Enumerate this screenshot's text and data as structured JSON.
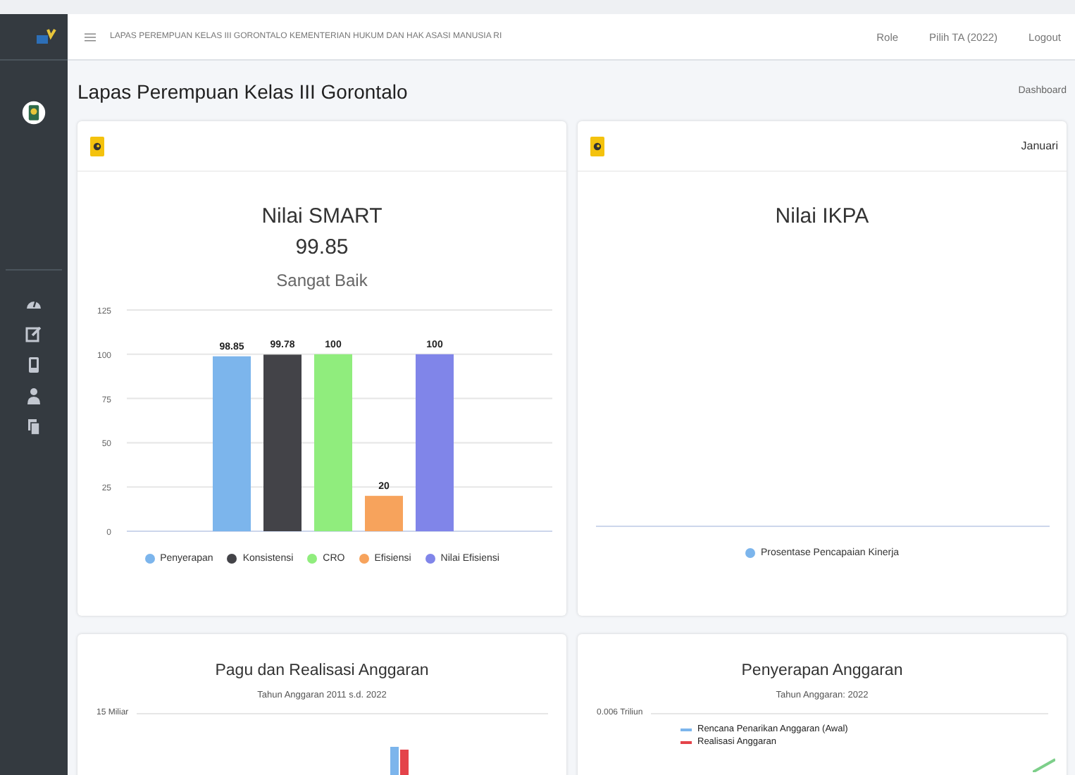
{
  "topbar": {
    "title": "LAPAS PEREMPUAN KELAS III GORONTALO KEMENTERIAN HUKUM DAN HAK ASASI MANUSIA RI",
    "links": [
      "Role",
      "Pilih TA (2022)",
      "Logout"
    ]
  },
  "page": {
    "title": "Lapas Perempuan Kelas III Gorontalo",
    "breadcrumb": "Dashboard"
  },
  "smart_card": {
    "title": "Nilai SMART",
    "score": "99.85",
    "rating": "Sangat Baik",
    "chart_data": {
      "type": "bar",
      "ylim": [
        0,
        125
      ],
      "yticks": [
        0,
        25,
        50,
        75,
        100,
        125
      ],
      "data_labels": true,
      "grid": true,
      "series": [
        {
          "name": "Penyerapan",
          "color": "#7cb5ec",
          "values": [
            98.85
          ]
        },
        {
          "name": "Konsistensi",
          "color": "#434348",
          "values": [
            99.78
          ]
        },
        {
          "name": "CRO",
          "color": "#90ed7d",
          "values": [
            100
          ]
        },
        {
          "name": "Efisiensi",
          "color": "#f7a35c",
          "values": [
            20
          ]
        },
        {
          "name": "Nilai Efisiensi",
          "color": "#8085e9",
          "values": [
            100
          ]
        }
      ]
    }
  },
  "ikpa_card": {
    "month": "Januari",
    "title": "Nilai IKPA",
    "legend": [
      {
        "name": "Prosentase Pencapaian Kinerja",
        "color": "#7cb5ec"
      }
    ]
  },
  "pagu_card": {
    "title": "Pagu dan Realisasi Anggaran",
    "subtitle": "Tahun Anggaran 2011 s.d. 2022",
    "axis_label": "15 Miliar"
  },
  "penyerapan_card": {
    "title": "Penyerapan Anggaran",
    "subtitle": "Tahun Anggaran: 2022",
    "axis_label": "0.006 Triliun",
    "legend": [
      {
        "name": "Rencana Penarikan Anggaran (Awal)",
        "color": "#7cb5ec"
      },
      {
        "name": "Realisasi Anggaran",
        "color": "#e4434a"
      }
    ]
  }
}
